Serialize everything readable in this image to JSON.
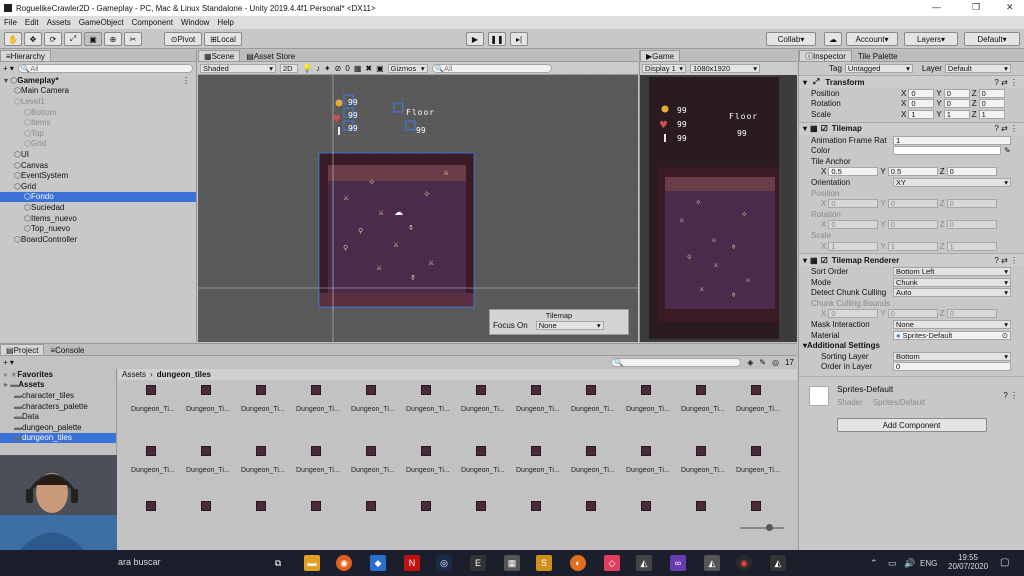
{
  "title": {
    "text": "RoguelikeCrawler2D - Gameplay - PC, Mac & Linux Standalone - Unity 2019.4.4f1 Personal* <DX11>"
  },
  "menu": [
    "File",
    "Edit",
    "Assets",
    "GameObject",
    "Component",
    "Window",
    "Help"
  ],
  "toolbar": {
    "pivot": "Pivot",
    "local": "Local",
    "collab": "Collab",
    "account": "Account",
    "layers": "Layers",
    "layout": "Default"
  },
  "hierarchy": {
    "tab": "Hierarchy",
    "search_placeholder": "All",
    "items": [
      {
        "label": "Gameplay*",
        "depth": 0,
        "bold": true
      },
      {
        "label": "Main Camera",
        "depth": 1
      },
      {
        "label": "Level1",
        "depth": 1,
        "dim": true
      },
      {
        "label": "Bottom",
        "depth": 2,
        "dim": true
      },
      {
        "label": "Items",
        "depth": 2,
        "dim": true
      },
      {
        "label": "Top",
        "depth": 2,
        "dim": true
      },
      {
        "label": "Grid",
        "depth": 2,
        "dim": true
      },
      {
        "label": "UI",
        "depth": 1
      },
      {
        "label": "Canvas",
        "depth": 1
      },
      {
        "label": "EventSystem",
        "depth": 1
      },
      {
        "label": "Grid",
        "depth": 1
      },
      {
        "label": "Fondo",
        "depth": 2,
        "selected": true
      },
      {
        "label": "Suciedad",
        "depth": 2
      },
      {
        "label": "Items_nuevo",
        "depth": 2
      },
      {
        "label": "Top_nuevo",
        "depth": 2
      },
      {
        "label": "BoardController",
        "depth": 1
      }
    ]
  },
  "scene": {
    "tab": "Scene",
    "tab2": "Asset Store",
    "shading": "Shaded",
    "mode2d": "2D",
    "fx_count": "0",
    "gizmos": "Gizmos",
    "search_placeholder": "All",
    "hud_values": [
      "99",
      "99",
      "99"
    ],
    "hud_t_values": [
      "99"
    ],
    "floor_label": "Floor",
    "tilemap_overlay": {
      "title": "Tilemap",
      "focus_label": "Focus On",
      "focus_value": "None"
    }
  },
  "game": {
    "tab": "Game",
    "display": "Display 1",
    "resolution": "1080x1920",
    "hud_values": [
      "99",
      "99",
      "99"
    ],
    "floor_label": "Floor",
    "floor_value": "99"
  },
  "inspector": {
    "tab": "Inspector",
    "tab2": "Tile Palette",
    "tag_label": "Tag",
    "tag_value": "Untagged",
    "layer_label": "Layer",
    "layer_value": "Default",
    "transform": {
      "title": "Transform",
      "position": {
        "label": "Position",
        "x": "0",
        "y": "0",
        "z": "0"
      },
      "rotation": {
        "label": "Rotation",
        "x": "0",
        "y": "0",
        "z": "0"
      },
      "scale": {
        "label": "Scale",
        "x": "1",
        "y": "1",
        "z": "1"
      }
    },
    "tilemap": {
      "title": "Tilemap",
      "anim_label": "Animation Frame Rat",
      "anim_value": "1",
      "color_label": "Color",
      "anchor_label": "Tile Anchor",
      "anchor": {
        "x": "0.5",
        "y": "0.5",
        "z": "0"
      },
      "orientation_label": "Orientation",
      "orientation_value": "XY",
      "position": {
        "label": "Position",
        "x": "0",
        "y": "0",
        "z": "0"
      },
      "rotation": {
        "label": "Rotation",
        "x": "0",
        "y": "0",
        "z": "0"
      },
      "scale": {
        "label": "Scale",
        "x": "1",
        "y": "1",
        "z": "1"
      }
    },
    "renderer": {
      "title": "Tilemap Renderer",
      "sort_order_label": "Sort Order",
      "sort_order_value": "Bottom Left",
      "mode_label": "Mode",
      "mode_value": "Chunk",
      "detect_label": "Detect Chunk Culling",
      "detect_value": "Auto",
      "bounds_label": "Chunk Culling Bounds",
      "bounds": {
        "x": "0",
        "y": "0",
        "z": "0"
      },
      "mask_label": "Mask Interaction",
      "mask_value": "None",
      "material_label": "Material",
      "material_value": "Sprites-Default",
      "additional_label": "Additional Settings",
      "sorting_label": "Sorting Layer",
      "sorting_value": "Bottom",
      "order_label": "Order in Layer",
      "order_value": "0"
    },
    "material": {
      "name": "Sprites-Default",
      "shader_label": "Shader",
      "shader_value": "Sprites/Default"
    },
    "add_component": "Add Component"
  },
  "project": {
    "tab": "Project",
    "tab2": "Console",
    "badge": "17",
    "breadcrumb_root": "Assets",
    "breadcrumb_leaf": "dungeon_tiles",
    "tree": [
      {
        "label": "Favorites",
        "bold": true,
        "depth": 0
      },
      {
        "label": "Assets",
        "bold": true,
        "depth": 0
      },
      {
        "label": "character_tiles",
        "depth": 1
      },
      {
        "label": "characters_palette",
        "depth": 1
      },
      {
        "label": "Data",
        "depth": 1
      },
      {
        "label": "dungeon_palette",
        "depth": 1
      },
      {
        "label": "dungeon_tiles",
        "depth": 1,
        "selected": true
      }
    ],
    "asset_label": "Dungeon_Ti..."
  },
  "taskbar": {
    "search": "ara buscar",
    "lang": "ENG",
    "time": "19:55",
    "date": "20/07/2020"
  }
}
